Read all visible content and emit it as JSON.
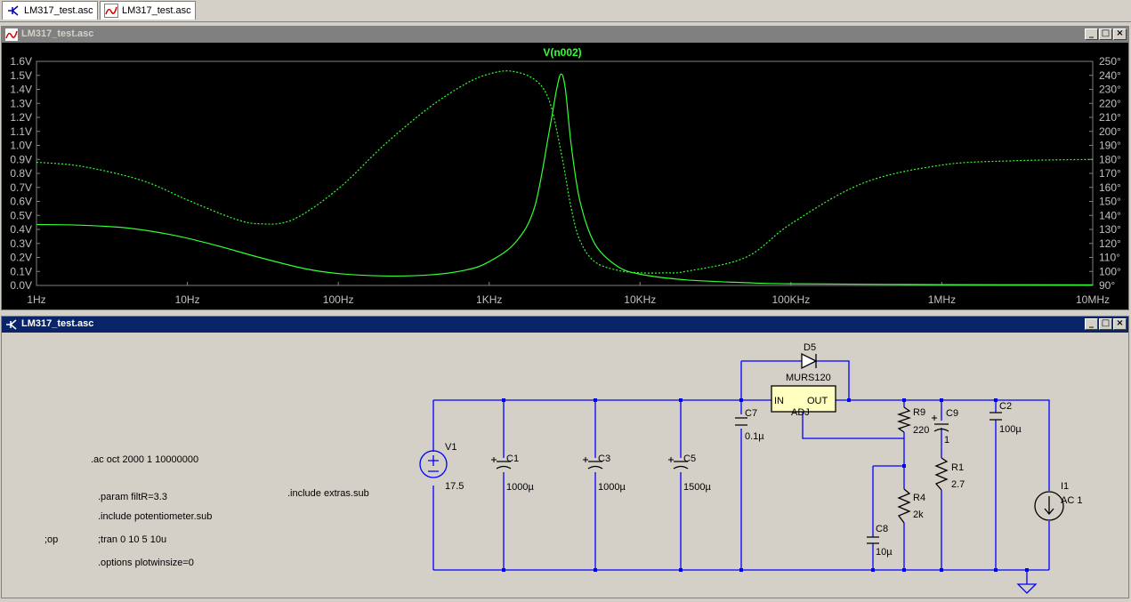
{
  "tabs": [
    {
      "label": "LM317_test.asc",
      "icon": "schematic-icon"
    },
    {
      "label": "LM317_test.asc",
      "icon": "waveform-icon"
    }
  ],
  "plot_window": {
    "title": "LM317_test.asc",
    "trace_label": "V(n002)",
    "buttons": [
      "_",
      "□",
      "×"
    ]
  },
  "schematic_window": {
    "title": "LM317_test.asc",
    "buttons": [
      "_",
      "□",
      "×"
    ],
    "directives": [
      ".ac oct 2000 1 10000000",
      ".param filtR=3.3",
      ".include potentiometer.sub",
      ";tran 0 10 5 10u",
      ".options plotwinsize=0",
      ";op",
      ".include extras.sub"
    ],
    "components": [
      {
        "name": "V1",
        "value": "17.5"
      },
      {
        "name": "C1",
        "value": "1000µ"
      },
      {
        "name": "C3",
        "value": "1000µ"
      },
      {
        "name": "C5",
        "value": "1500µ"
      },
      {
        "name": "C7",
        "value": "0.1µ"
      },
      {
        "name": "D5",
        "value": "MURS120"
      },
      {
        "name": "R9",
        "value": "220"
      },
      {
        "name": "C9",
        "value": "1"
      },
      {
        "name": "C2",
        "value": "100µ"
      },
      {
        "name": "R1",
        "value": "2.7"
      },
      {
        "name": "R4",
        "value": "2k"
      },
      {
        "name": "C8",
        "value": "10µ"
      },
      {
        "name": "I1",
        "value": "AC 1"
      }
    ],
    "ic_pins": {
      "in": "IN",
      "out": "OUT",
      "adj": "ADJ"
    }
  },
  "colors": {
    "trace": "#33ff33",
    "wire": "#0000ff",
    "plot_bg": "#000000",
    "component": "#000000",
    "ic_fill": "#ffffc0"
  },
  "chart_data": {
    "type": "line",
    "title": "V(n002)",
    "x_scale": "log",
    "xlim": [
      1,
      10000000
    ],
    "x_ticks": [
      "1Hz",
      "10Hz",
      "100Hz",
      "1KHz",
      "10KHz",
      "100KHz",
      "1MHz",
      "10MHz"
    ],
    "y_left": {
      "lim": [
        0,
        1.6
      ],
      "unit": "V",
      "ticks": [
        "0.0V",
        "0.1V",
        "0.2V",
        "0.3V",
        "0.4V",
        "0.5V",
        "0.6V",
        "0.7V",
        "0.8V",
        "0.9V",
        "1.0V",
        "1.1V",
        "1.2V",
        "1.3V",
        "1.4V",
        "1.5V",
        "1.6V"
      ]
    },
    "y_right": {
      "lim": [
        90,
        250
      ],
      "unit": "°",
      "ticks": [
        "90°",
        "100°",
        "110°",
        "120°",
        "130°",
        "140°",
        "150°",
        "160°",
        "170°",
        "180°",
        "190°",
        "200°",
        "210°",
        "220°",
        "230°",
        "240°",
        "250°"
      ]
    },
    "grid": false,
    "series": [
      {
        "name": "magnitude",
        "axis": "left",
        "style": "solid",
        "x": [
          1,
          2,
          4,
          8,
          15,
          30,
          60,
          100,
          200,
          400,
          700,
          1000,
          1500,
          2000,
          2500,
          2800,
          3000,
          3200,
          3500,
          4000,
          5000,
          7000,
          10000,
          20000,
          50000,
          100000,
          1000000,
          10000000
        ],
        "y": [
          0.435,
          0.43,
          0.41,
          0.36,
          0.29,
          0.2,
          0.12,
          0.085,
          0.068,
          0.075,
          0.11,
          0.17,
          0.31,
          0.56,
          1.1,
          1.4,
          1.51,
          1.4,
          1.0,
          0.6,
          0.3,
          0.14,
          0.08,
          0.04,
          0.02,
          0.012,
          0.006,
          0.004
        ]
      },
      {
        "name": "phase",
        "axis": "right",
        "style": "dashed",
        "x": [
          1,
          2,
          5,
          10,
          20,
          30,
          50,
          100,
          200,
          400,
          700,
          1000,
          1400,
          2000,
          2500,
          3000,
          3500,
          4000,
          5000,
          7000,
          10000,
          15000,
          20000,
          50000,
          100000,
          300000,
          1000000,
          3000000,
          10000000
        ],
        "y": [
          178,
          175,
          165,
          151,
          138,
          134,
          137,
          159,
          190,
          217,
          234,
          241,
          243,
          237,
          222,
          185,
          145,
          122,
          107,
          101,
          99,
          99,
          100,
          110,
          134,
          163,
          176,
          179,
          180
        ]
      }
    ]
  }
}
